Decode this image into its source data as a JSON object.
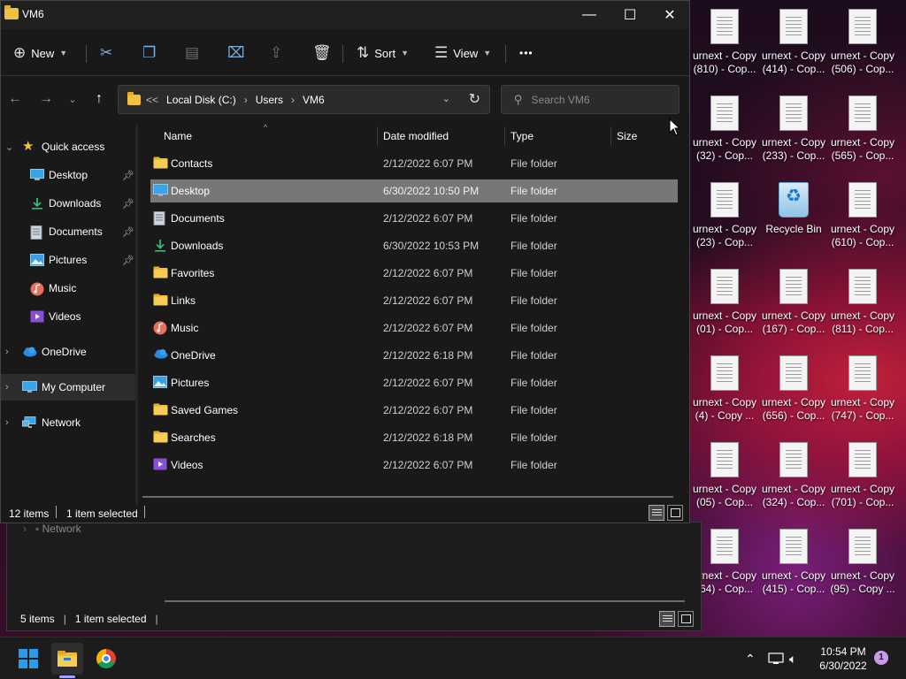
{
  "window": {
    "title": "VM6",
    "controls": {
      "minimize": "—",
      "maximize": "☐",
      "close": "✕"
    }
  },
  "toolbar": {
    "new_label": "New",
    "sort_label": "Sort",
    "view_label": "View",
    "more_label": "•••"
  },
  "address": {
    "overflow": "<<",
    "crumbs": [
      "Local Disk (C:)",
      "Users",
      "VM6"
    ]
  },
  "search": {
    "placeholder": "Search VM6"
  },
  "sidebar": {
    "quick_access": "Quick access",
    "pinned": [
      {
        "label": "Desktop",
        "pinned": true
      },
      {
        "label": "Downloads",
        "pinned": true
      },
      {
        "label": "Documents",
        "pinned": true
      },
      {
        "label": "Pictures",
        "pinned": true
      },
      {
        "label": "Music",
        "pinned": false
      },
      {
        "label": "Videos",
        "pinned": false
      }
    ],
    "onedrive": "OneDrive",
    "my_computer": "My Computer",
    "network": "Network"
  },
  "columns": {
    "name": "Name",
    "date": "Date modified",
    "type": "Type",
    "size": "Size"
  },
  "files": [
    {
      "name": "Contacts",
      "date": "2/12/2022 6:07 PM",
      "type": "File folder",
      "icon": "folder-icon"
    },
    {
      "name": "Desktop",
      "date": "6/30/2022 10:50 PM",
      "type": "File folder",
      "icon": "desktop-icon",
      "selected": true
    },
    {
      "name": "Documents",
      "date": "2/12/2022 6:07 PM",
      "type": "File folder",
      "icon": "documents-icon"
    },
    {
      "name": "Downloads",
      "date": "6/30/2022 10:53 PM",
      "type": "File folder",
      "icon": "download-icon"
    },
    {
      "name": "Favorites",
      "date": "2/12/2022 6:07 PM",
      "type": "File folder",
      "icon": "folder-icon"
    },
    {
      "name": "Links",
      "date": "2/12/2022 6:07 PM",
      "type": "File folder",
      "icon": "folder-icon"
    },
    {
      "name": "Music",
      "date": "2/12/2022 6:07 PM",
      "type": "File folder",
      "icon": "music-icon"
    },
    {
      "name": "OneDrive",
      "date": "2/12/2022 6:18 PM",
      "type": "File folder",
      "icon": "cloud-icon"
    },
    {
      "name": "Pictures",
      "date": "2/12/2022 6:07 PM",
      "type": "File folder",
      "icon": "pictures-icon"
    },
    {
      "name": "Saved Games",
      "date": "2/12/2022 6:07 PM",
      "type": "File folder",
      "icon": "folder-icon"
    },
    {
      "name": "Searches",
      "date": "2/12/2022 6:18 PM",
      "type": "File folder",
      "icon": "folder-icon"
    },
    {
      "name": "Videos",
      "date": "2/12/2022 6:07 PM",
      "type": "File folder",
      "icon": "videos-icon"
    }
  ],
  "status": {
    "items": "12 items",
    "selected": "1 item selected"
  },
  "bg_window": {
    "ghost_network": "Network",
    "status_items": "5 items",
    "status_selected": "1 item selected"
  },
  "desktop": {
    "icons": [
      [
        "urnext - Copy",
        "(810) - Cop..."
      ],
      [
        "urnext - Copy",
        "(414) - Cop..."
      ],
      [
        "urnext - Copy",
        "(506) - Cop..."
      ],
      [
        "urnext - Copy",
        "(32) - Cop..."
      ],
      [
        "urnext - Copy",
        "(233) - Cop..."
      ],
      [
        "urnext - Copy",
        "(565) - Cop..."
      ],
      [
        "urnext - Copy",
        "(23) - Cop..."
      ],
      [
        "Recycle Bin",
        ""
      ],
      [
        "urnext - Copy",
        "(610) - Cop..."
      ],
      [
        "urnext - Copy",
        "(01) - Cop..."
      ],
      [
        "urnext - Copy",
        "(167) - Cop..."
      ],
      [
        "urnext - Copy",
        "(811) - Cop..."
      ],
      [
        "urnext - Copy",
        "(4) - Copy ..."
      ],
      [
        "urnext - Copy",
        "(656) - Cop..."
      ],
      [
        "urnext - Copy",
        "(747) - Cop..."
      ],
      [
        "urnext - Copy",
        "(05) - Cop..."
      ],
      [
        "urnext - Copy",
        "(324) - Cop..."
      ],
      [
        "urnext - Copy",
        "(701) - Cop..."
      ],
      [
        "urnext - Copy",
        "(64) - Cop..."
      ],
      [
        "urnext - Copy",
        "(415) - Cop..."
      ],
      [
        "urnext - Copy",
        "(95) - Copy ..."
      ]
    ]
  },
  "taskbar": {
    "time": "10:54 PM",
    "date": "6/30/2022",
    "notifications": "1"
  },
  "colors": {
    "accent": "#2c9be8",
    "folder": "#f0c040",
    "selection": "#777777"
  }
}
